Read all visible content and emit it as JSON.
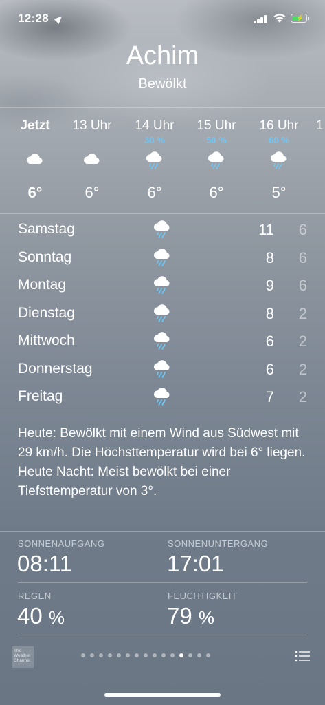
{
  "status_bar": {
    "time": "12:28"
  },
  "header": {
    "city": "Achim",
    "condition": "Bewölkt"
  },
  "hourly": [
    {
      "label": "Jetzt",
      "precip": "",
      "icon": "cloud-icon",
      "temp": "6°"
    },
    {
      "label": "13 Uhr",
      "precip": "",
      "icon": "cloud-icon",
      "temp": "6°"
    },
    {
      "label": "14 Uhr",
      "precip": "30 %",
      "icon": "cloud-rain-icon",
      "temp": "6°"
    },
    {
      "label": "15 Uhr",
      "precip": "50 %",
      "icon": "cloud-rain-icon",
      "temp": "6°"
    },
    {
      "label": "16 Uhr",
      "precip": "60 %",
      "icon": "cloud-rain-icon",
      "temp": "5°"
    },
    {
      "label": "1",
      "precip": "",
      "icon": "",
      "temp": ""
    }
  ],
  "daily": [
    {
      "day": "Samstag",
      "icon": "cloud-rain-icon",
      "high": "11",
      "low": "6"
    },
    {
      "day": "Sonntag",
      "icon": "cloud-rain-icon",
      "high": "8",
      "low": "6"
    },
    {
      "day": "Montag",
      "icon": "cloud-rain-icon",
      "high": "9",
      "low": "6"
    },
    {
      "day": "Dienstag",
      "icon": "cloud-rain-icon",
      "high": "8",
      "low": "2"
    },
    {
      "day": "Mittwoch",
      "icon": "cloud-rain-icon",
      "high": "6",
      "low": "2"
    },
    {
      "day": "Donnerstag",
      "icon": "cloud-rain-icon",
      "high": "6",
      "low": "2"
    },
    {
      "day": "Freitag",
      "icon": "cloud-rain-icon",
      "high": "7",
      "low": "2"
    }
  ],
  "summary": "Heute: Bewölkt mit einem Wind aus Südwest mit 29 km/h. Die Höchsttemperatur wird bei 6° liegen. Heute Nacht: Meist bewölkt bei einer Tiefsttemperatur von 3°.",
  "details": {
    "sunrise_label": "SONNENAUFGANG",
    "sunrise_value": "08:11",
    "sunset_label": "SONNENUNTERGANG",
    "sunset_value": "17:01",
    "rain_label": "REGEN",
    "rain_value": "40",
    "rain_unit": "%",
    "humidity_label": "FEUCHTIGKEIT",
    "humidity_value": "79",
    "humidity_unit": "%"
  },
  "bottom_bar": {
    "logo_text": "The Weather Channel",
    "page_count": 15,
    "active_page": 11
  },
  "colors": {
    "precip": "#6fc7f5",
    "battery": "#4cd964"
  }
}
